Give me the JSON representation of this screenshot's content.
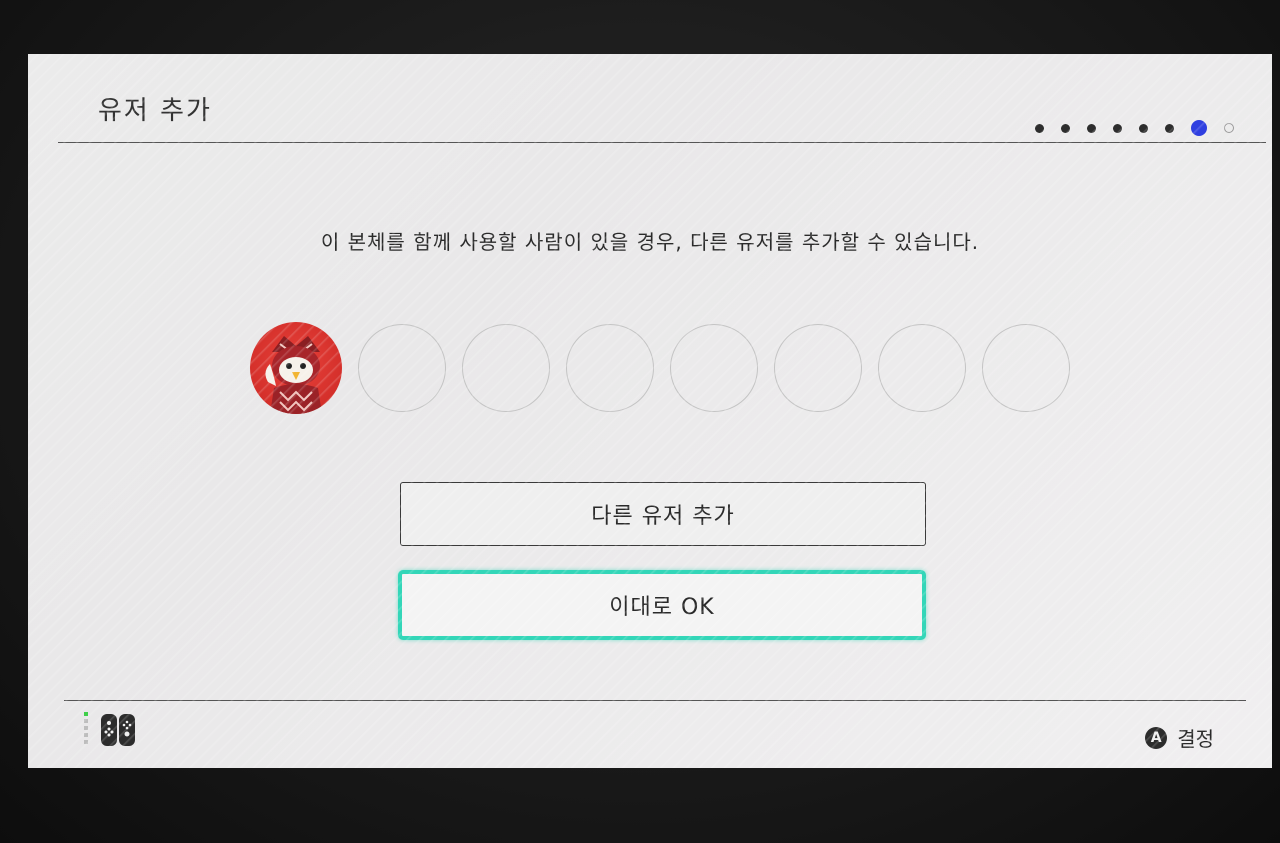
{
  "header": {
    "title": "유저 추가",
    "progress": {
      "total_steps": 8,
      "current_step": 7
    }
  },
  "main": {
    "description": "이 본체를 함께 사용할 사람이 있을 경우, 다른 유저를 추가할 수 있습니다.",
    "user_slots": {
      "filled": 1,
      "empty": 7
    },
    "add_user_label": "다른 유저 추가",
    "ok_label": "이대로 OK"
  },
  "footer": {
    "confirm_button_glyph": "A",
    "confirm_label": "결정"
  },
  "colors": {
    "accent_focus": "#33d6b8",
    "progress_active": "#2f3fe0",
    "avatar_bg": "#d42f2a"
  },
  "icons": {
    "avatar": "owl-character-icon",
    "console": "switch-console-icon"
  }
}
